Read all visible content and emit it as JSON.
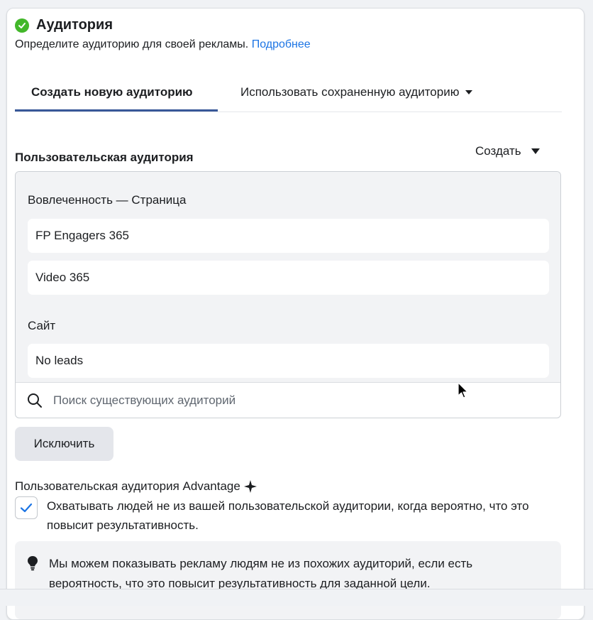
{
  "audience": {
    "title": "Аудитория",
    "subtitle": "Определите аудиторию для своей рекламы.",
    "learn_more": "Подробнее",
    "tabs": [
      {
        "label": "Создать новую аудиторию",
        "active": true
      },
      {
        "label": "Использовать сохраненную аудиторию",
        "active": false
      }
    ],
    "custom": {
      "label": "Пользовательская аудитория",
      "create_button": "Создать",
      "groups": [
        {
          "label": "Вовлеченность — Страница",
          "items": [
            "FP Engagers 365",
            "Video 365"
          ]
        },
        {
          "label": "Сайт",
          "items": [
            "No leads"
          ]
        }
      ],
      "search_placeholder": "Поиск существующих аудиторий"
    },
    "exclude_button": "Исключить",
    "advantage": {
      "label": "Пользовательская аудитория Advantage",
      "checked": true,
      "checkbox_text": "Охватывать людей не из вашей пользовательской аудитории, когда вероятно, что это повысит результативность."
    },
    "tip": {
      "text": "Мы можем показывать рекламу людям не из похожих аудиторий, если есть вероятность, что это повысит результативность для заданной цели."
    }
  },
  "colors": {
    "accent": "#1b74e4",
    "success": "#42b72a",
    "tab_indicator": "#385898",
    "checkbox": "#1b74e4"
  },
  "icons": [
    "check-circle-icon",
    "caret-down-icon",
    "search-icon",
    "sparkle-icon",
    "checkmark-icon",
    "lightbulb-icon",
    "mouse-cursor-icon"
  ]
}
